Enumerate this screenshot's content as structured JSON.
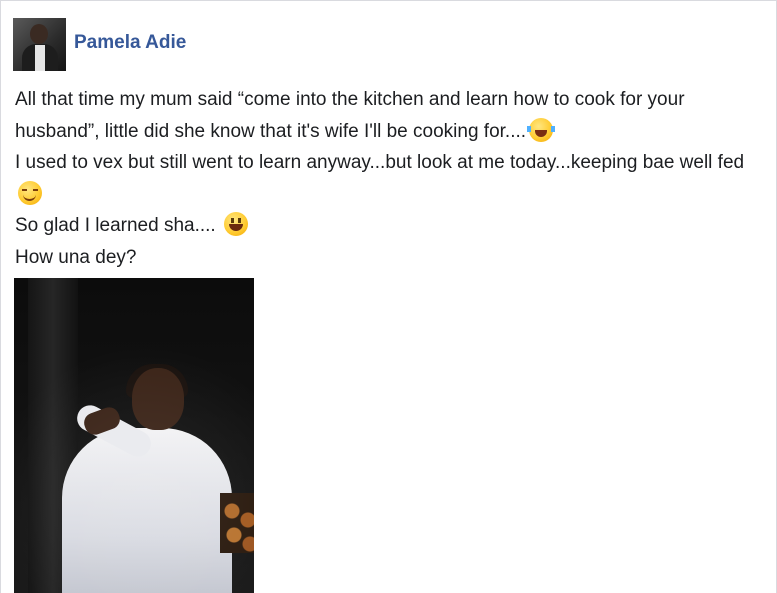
{
  "post": {
    "author": "Pamela Adie",
    "avatar_icon": "profile-photo",
    "lines": [
      "All that time my mum said “come into the kitchen and learn how to cook for your husband”, little did she know that it's wife I'll be cooking for....",
      "I used to vex but still went to learn anyway...but look at me today...keeping bae well fed",
      "So glad I learned sha....",
      "How una dey?"
    ],
    "emojis": [
      "face-with-tears-of-joy",
      "smirking-face",
      "grinning-face"
    ],
    "photo_icon": "post-photo"
  },
  "colors": {
    "author_link": "#365899",
    "text": "#1c1e21",
    "border": "#d9dadf"
  }
}
